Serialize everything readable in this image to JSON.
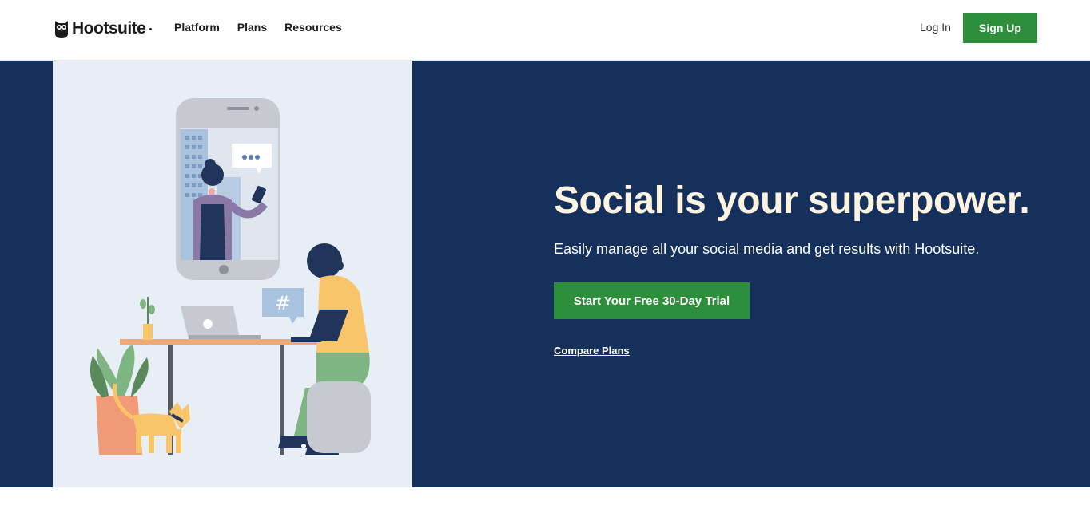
{
  "header": {
    "logo_text": "Hootsuite",
    "nav": [
      {
        "label": "Platform"
      },
      {
        "label": "Plans"
      },
      {
        "label": "Resources"
      }
    ],
    "login_label": "Log In",
    "signup_label": "Sign Up"
  },
  "hero": {
    "title": "Social is your superpower.",
    "subtitle": "Easily manage all your social media and get results with Hootsuite.",
    "cta_label": "Start Your Free 30-Day Trial",
    "compare_label": "Compare Plans",
    "illustration_hashtag": "#"
  },
  "colors": {
    "brand_green": "#2d8f3c",
    "hero_bg": "#15305b",
    "hero_title": "#fdf3e1",
    "illustration_bg": "#e8eef6"
  }
}
